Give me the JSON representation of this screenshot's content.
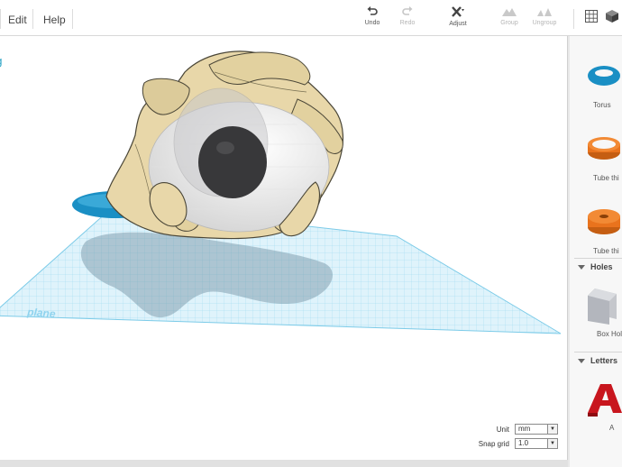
{
  "menu": {
    "edit": "Edit",
    "help": "Help"
  },
  "toolbar": {
    "undo": "Undo",
    "redo": "Redo",
    "adjust": "Adjust",
    "group": "Group",
    "ungroup": "Ungroup"
  },
  "design": {
    "title_fragment": "ng"
  },
  "workplane": {
    "label": "plane"
  },
  "settings": {
    "unit_label": "Unit",
    "unit_value": "mm",
    "snap_label": "Snap grid",
    "snap_value": "1.0"
  },
  "sidebar": {
    "shapes": [
      {
        "name": "Torus",
        "icon": "torus-icon",
        "color": "#1a8fc4"
      },
      {
        "name": "Tube thi",
        "icon": "tube-thin-icon",
        "color": "#e9731d"
      },
      {
        "name": "Tube thi",
        "icon": "tube-thick-icon",
        "color": "#e9731d"
      }
    ],
    "holes_title": "Holes",
    "hole_shape": {
      "name": "Box Hol",
      "icon": "box-hole-icon"
    },
    "letters_title": "Letters",
    "letter_shape": {
      "name": "A",
      "icon": "letter-a-icon",
      "color": "#c8161e"
    }
  },
  "colors": {
    "accent": "#2aa3c5",
    "hand": "#e8d7a9",
    "eye": "#f0f0f0",
    "pupil": "#3a3a3c",
    "grid": "#8fd3ee"
  }
}
